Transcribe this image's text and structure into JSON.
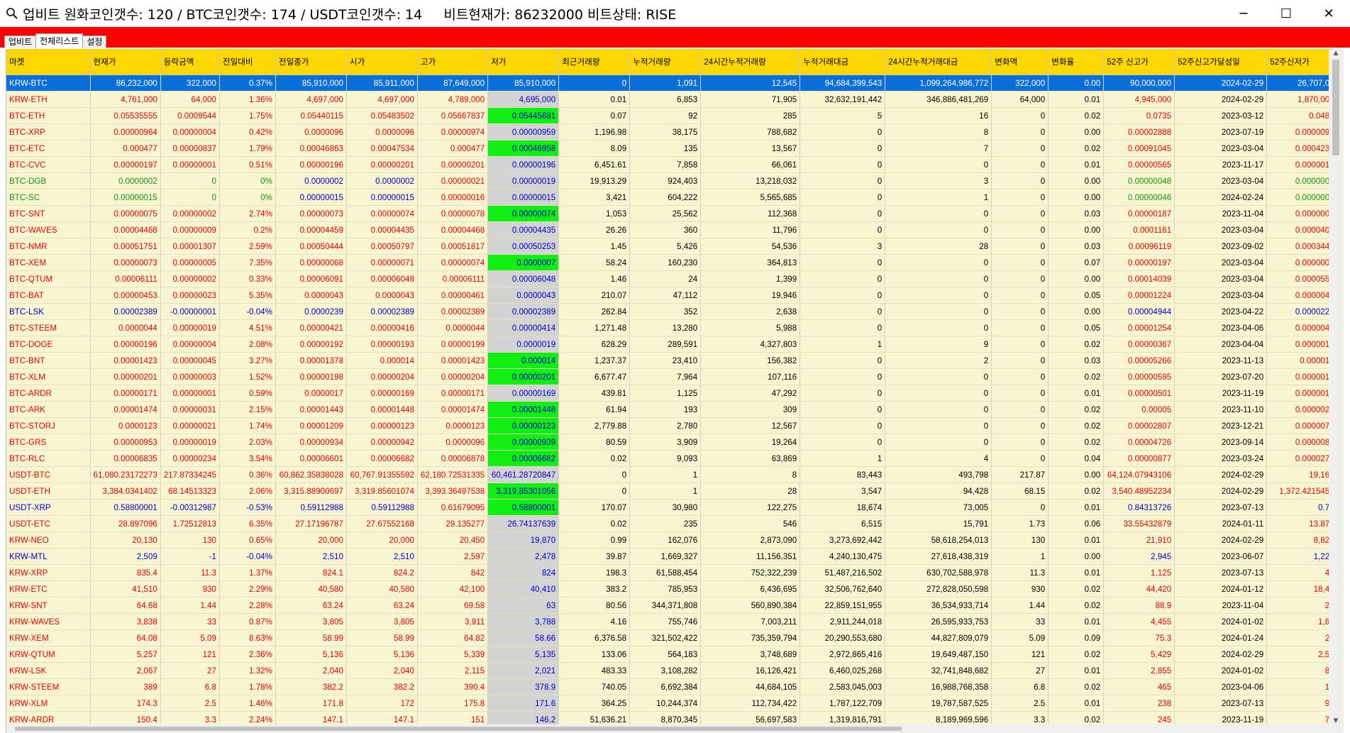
{
  "window": {
    "title": "업비트 원화코인갯수: 120 / BTC코인갯수: 174 / USDT코인갯수: 14     비트현재가: 86232000 비트상태: RISE",
    "minimize": "─",
    "maximize": "☐",
    "close": "✕"
  },
  "tabs": [
    "업비트",
    "전체리스트",
    "설정"
  ],
  "columns": [
    "마켓",
    "현재가",
    "등락금액",
    "전일대비",
    "전일종가",
    "시가",
    "고가",
    "저가",
    "최근거래량",
    "누적거래량",
    "24시간누적거래량",
    "누적거래대금",
    "24시간누적거래대금",
    "변화액",
    "변화율",
    "52주 신고가",
    "52주신고가달성일",
    "52주신저가"
  ],
  "rows": [
    {
      "c": [
        "KRW-BTC",
        "86,232,000",
        "322,000",
        "0.37%",
        "85,910,000",
        "85,911,000",
        "87,649,000",
        "85,910,000",
        "0",
        "1,091",
        "12,545",
        "94,684,399,543",
        "1,099,264,986,772",
        "322,000",
        "0.00",
        "90,000,000",
        "2024-02-29",
        "26,707,0"
      ],
      "color": "red",
      "low": "gray",
      "sel": true
    },
    {
      "c": [
        "KRW-ETH",
        "4,761,000",
        "64,000",
        "1.36%",
        "4,697,000",
        "4,697,000",
        "4,789,000",
        "4,695,000",
        "0.01",
        "6,853",
        "71,905",
        "32,632,191,442",
        "346,886,481,269",
        "64,000",
        "0.01",
        "4,945,000",
        "2024-02-29",
        "1,870,00"
      ],
      "color": "red",
      "low": "gray"
    },
    {
      "c": [
        "BTC-ETH",
        "0.05535555",
        "0.0009544",
        "1.75%",
        "0.05440115",
        "0.05483502",
        "0.05667837",
        "0.05445681",
        "0.07",
        "92",
        "285",
        "5",
        "16",
        "0",
        "0.02",
        "0.0735",
        "2023-03-12",
        "0.048"
      ],
      "color": "red",
      "low": "green"
    },
    {
      "c": [
        "BTC-XRP",
        "0.00000964",
        "0.00000004",
        "0.42%",
        "0.0000096",
        "0.0000096",
        "0.00000974",
        "0.00000959",
        "1,196.98",
        "38,175",
        "788,682",
        "0",
        "8",
        "0",
        "0.00",
        "0.00002888",
        "2023-07-19",
        "0.000009"
      ],
      "color": "red",
      "low": "gray"
    },
    {
      "c": [
        "BTC-ETC",
        "0.000477",
        "0.00000837",
        "1.79%",
        "0.00046863",
        "0.00047534",
        "0.000477",
        "0.00046958",
        "8.09",
        "135",
        "13,567",
        "0",
        "7",
        "0",
        "0.02",
        "0.00091045",
        "2023-03-04",
        "0.000423"
      ],
      "color": "red",
      "low": "green"
    },
    {
      "c": [
        "BTC-CVC",
        "0.00000197",
        "0.00000001",
        "0.51%",
        "0.00000196",
        "0.00000201",
        "0.00000201",
        "0.00000196",
        "6,451.61",
        "7,858",
        "66,061",
        "0",
        "0",
        "0",
        "0.01",
        "0.00000565",
        "2023-11-17",
        "0.000001"
      ],
      "color": "red",
      "low": "gray"
    },
    {
      "c": [
        "BTC-DGB",
        "0.0000002",
        "0",
        "0%",
        "0.0000002",
        "0.0000002",
        "0.00000021",
        "0.00000019",
        "19,913.29",
        "924,403",
        "13,218,032",
        "0",
        "3",
        "0",
        "0.00",
        "0.00000048",
        "2023-03-04",
        "0.000000"
      ],
      "color": "green",
      "low": "gray"
    },
    {
      "c": [
        "BTC-SC",
        "0.00000015",
        "0",
        "0%",
        "0.00000015",
        "0.00000015",
        "0.00000016",
        "0.00000015",
        "3,421",
        "604,222",
        "5,565,685",
        "0",
        "1",
        "0",
        "0.00",
        "0.00000046",
        "2024-02-24",
        "0.000000"
      ],
      "color": "green",
      "low": "gray"
    },
    {
      "c": [
        "BTC-SNT",
        "0.00000075",
        "0.00000002",
        "2.74%",
        "0.00000073",
        "0.00000074",
        "0.00000078",
        "0.00000074",
        "1,053",
        "25,562",
        "112,368",
        "0",
        "0",
        "0",
        "0.03",
        "0.00000187",
        "2023-11-04",
        "0.000000"
      ],
      "color": "red",
      "low": "green"
    },
    {
      "c": [
        "BTC-WAVES",
        "0.00004468",
        "0.00000009",
        "0.2%",
        "0.00004459",
        "0.00004435",
        "0.00004468",
        "0.00004435",
        "26.26",
        "360",
        "11,796",
        "0",
        "0",
        "0",
        "0.00",
        "0.0001161",
        "2023-03-04",
        "0.000040"
      ],
      "color": "red",
      "low": "gray"
    },
    {
      "c": [
        "BTC-NMR",
        "0.00051751",
        "0.00001307",
        "2.59%",
        "0.00050444",
        "0.00050797",
        "0.00051817",
        "0.00050253",
        "1.45",
        "5,426",
        "54,536",
        "3",
        "28",
        "0",
        "0.03",
        "0.00096119",
        "2023-09-02",
        "0.000344"
      ],
      "color": "red",
      "low": "gray"
    },
    {
      "c": [
        "BTC-XEM",
        "0.00000073",
        "0.00000005",
        "7.35%",
        "0.00000068",
        "0.00000071",
        "0.00000074",
        "0.0000007",
        "58.24",
        "160,230",
        "364,813",
        "0",
        "0",
        "0",
        "0.07",
        "0.00000197",
        "2023-03-04",
        "0.000000"
      ],
      "color": "red",
      "low": "green"
    },
    {
      "c": [
        "BTC-QTUM",
        "0.00006111",
        "0.00000002",
        "0.33%",
        "0.00006091",
        "0.00006048",
        "0.00006111",
        "0.00006048",
        "1.46",
        "24",
        "1,399",
        "0",
        "0",
        "0",
        "0.00",
        "0.00014039",
        "2023-03-04",
        "0.000055"
      ],
      "color": "red",
      "low": "gray"
    },
    {
      "c": [
        "BTC-BAT",
        "0.00000453",
        "0.00000023",
        "5.35%",
        "0.0000043",
        "0.0000043",
        "0.00000461",
        "0.0000043",
        "210.07",
        "47,112",
        "19,946",
        "0",
        "0",
        "0",
        "0.05",
        "0.00001224",
        "2023-03-04",
        "0.000004"
      ],
      "color": "red",
      "low": "gray"
    },
    {
      "c": [
        "BTC-LSK",
        "0.00002389",
        "-0.00000001",
        "-0.04%",
        "0.0000239",
        "0.00002389",
        "0.00002389",
        "0.00002389",
        "262.84",
        "352",
        "2,638",
        "0",
        "0",
        "0",
        "0.00",
        "0.00004944",
        "2023-04-22",
        "0.000022"
      ],
      "color": "blue",
      "low": "gray"
    },
    {
      "c": [
        "BTC-STEEM",
        "0.0000044",
        "0.00000019",
        "4.51%",
        "0.00000421",
        "0.00000416",
        "0.0000044",
        "0.00000414",
        "1,271.48",
        "13,280",
        "5,988",
        "0",
        "0",
        "0",
        "0.05",
        "0.00001254",
        "2023-04-06",
        "0.000004"
      ],
      "color": "red",
      "low": "gray"
    },
    {
      "c": [
        "BTC-DOGE",
        "0.00000196",
        "0.00000004",
        "2.08%",
        "0.00000192",
        "0.00000193",
        "0.00000199",
        "0.0000019",
        "628.29",
        "289,591",
        "4,327,803",
        "1",
        "9",
        "0",
        "0.02",
        "0.00000367",
        "2023-04-04",
        "0.000001"
      ],
      "color": "red",
      "low": "gray"
    },
    {
      "c": [
        "BTC-BNT",
        "0.00001423",
        "0.00000045",
        "3.27%",
        "0.00001378",
        "0.000014",
        "0.00001423",
        "0.000014",
        "1,237.37",
        "23,410",
        "156,382",
        "0",
        "2",
        "0",
        "0.03",
        "0.00005266",
        "2023-11-13",
        "0.00001"
      ],
      "color": "red",
      "low": "green"
    },
    {
      "c": [
        "BTC-XLM",
        "0.00000201",
        "0.00000003",
        "1.52%",
        "0.00000198",
        "0.00000204",
        "0.00000204",
        "0.00000201",
        "6,677.47",
        "7,964",
        "107,116",
        "0",
        "0",
        "0",
        "0.02",
        "0.00000595",
        "2023-07-20",
        "0.000001"
      ],
      "color": "red",
      "low": "green"
    },
    {
      "c": [
        "BTC-ARDR",
        "0.00000171",
        "0.00000001",
        "0.59%",
        "0.0000017",
        "0.00000169",
        "0.00000171",
        "0.00000169",
        "439.81",
        "1,125",
        "47,292",
        "0",
        "0",
        "0",
        "0.01",
        "0.00000501",
        "2023-11-19",
        "0.000001"
      ],
      "color": "red",
      "low": "gray"
    },
    {
      "c": [
        "BTC-ARK",
        "0.00001474",
        "0.00000031",
        "2.15%",
        "0.00001443",
        "0.00001448",
        "0.00001474",
        "0.00001448",
        "61.94",
        "193",
        "309",
        "0",
        "0",
        "0",
        "0.02",
        "0.00005",
        "2023-11-10",
        "0.000002"
      ],
      "color": "red",
      "low": "green"
    },
    {
      "c": [
        "BTC-STORJ",
        "0.0000123",
        "0.00000021",
        "1.74%",
        "0.00001209",
        "0.00000123",
        "0.0000123",
        "0.00000123",
        "2,779.88",
        "2,780",
        "12,567",
        "0",
        "0",
        "0",
        "0.02",
        "0.00002807",
        "2023-12-21",
        "0.000007"
      ],
      "color": "red",
      "low": "green"
    },
    {
      "c": [
        "BTC-GRS",
        "0.00000953",
        "0.00000019",
        "2.03%",
        "0.00000934",
        "0.00000942",
        "0.0000096",
        "0.00000939",
        "80.59",
        "3,909",
        "19,264",
        "0",
        "0",
        "0",
        "0.02",
        "0.00004726",
        "2023-09-14",
        "0.000008"
      ],
      "color": "red",
      "low": "green"
    },
    {
      "c": [
        "BTC-RLC",
        "0.00006835",
        "0.00000234",
        "3.54%",
        "0.00006601",
        "0.00006682",
        "0.00006878",
        "0.00006682",
        "0.02",
        "9,093",
        "63,869",
        "1",
        "4",
        "0",
        "0.04",
        "0.00000877",
        "2023-03-24",
        "0.000027"
      ],
      "color": "red",
      "low": "green"
    },
    {
      "c": [
        "USDT-BTC",
        "61,080.23172273",
        "217.87334245",
        "0.36%",
        "60,862.35838028",
        "60,767.91355592",
        "62,180.72531335",
        "60,461.28720847",
        "0",
        "1",
        "8",
        "83,443",
        "493,798",
        "217.87",
        "0.00",
        "64,124.07943106",
        "2024-02-29",
        "19,16"
      ],
      "color": "red",
      "low": "gray"
    },
    {
      "c": [
        "USDT-ETH",
        "3,384.0341402",
        "68.14513323",
        "2.06%",
        "3,315.88900697",
        "3,319.85601074",
        "3,393.36497538",
        "3,319.85301056",
        "0",
        "1",
        "28",
        "3,547",
        "94,428",
        "68.15",
        "0.02",
        "3,540.48952234",
        "2024-02-29",
        "1,372.421545"
      ],
      "color": "red",
      "low": "green"
    },
    {
      "c": [
        "USDT-XRP",
        "0.58800001",
        "-0.00312987",
        "-0.53%",
        "0.59112988",
        "0.59112988",
        "0.61679095",
        "0.58800001",
        "170.07",
        "30,980",
        "122,275",
        "18,674",
        "73,005",
        "0",
        "0.01",
        "0.84313726",
        "2023-07-13",
        "0.7"
      ],
      "color": "blue",
      "low": "green"
    },
    {
      "c": [
        "USDT-ETC",
        "28.897096",
        "1.72512813",
        "6.35%",
        "27.17196787",
        "27.67552168",
        "29.135277",
        "26.74137639",
        "0.02",
        "235",
        "546",
        "6,515",
        "15,791",
        "1.73",
        "0.06",
        "33.55432879",
        "2024-01-11",
        "13.87"
      ],
      "color": "red",
      "low": "gray"
    },
    {
      "c": [
        "KRW-NEO",
        "20,130",
        "130",
        "0.65%",
        "20,000",
        "20,000",
        "20,450",
        "19,870",
        "0.99",
        "162,076",
        "2,873,090",
        "3,273,692,442",
        "58,618,254,013",
        "130",
        "0.01",
        "21,910",
        "2024-02-29",
        "8,82"
      ],
      "color": "red",
      "low": "gray"
    },
    {
      "c": [
        "KRW-MTL",
        "2,509",
        "-1",
        "-0.04%",
        "2,510",
        "2,510",
        "2,597",
        "2,478",
        "39.87",
        "1,669,327",
        "11,156,351",
        "4,240,130,475",
        "27,618,438,319",
        "1",
        "0.00",
        "2,945",
        "2023-06-07",
        "1,22"
      ],
      "color": "blue",
      "low": "gray"
    },
    {
      "c": [
        "KRW-XRP",
        "835.4",
        "11.3",
        "1.37%",
        "824.1",
        "824.2",
        "842",
        "824",
        "198.3",
        "61,588,454",
        "752,322,239",
        "51,487,216,502",
        "630,702,588,978",
        "11.3",
        "0.01",
        "1,125",
        "2023-07-13",
        "4"
      ],
      "color": "red",
      "low": "gray"
    },
    {
      "c": [
        "KRW-ETC",
        "41,510",
        "930",
        "2.29%",
        "40,580",
        "40,580",
        "42,100",
        "40,410",
        "383.2",
        "785,953",
        "6,436,695",
        "32,506,762,640",
        "272,828,050,598",
        "930",
        "0.02",
        "44,420",
        "2024-01-12",
        "18,4"
      ],
      "color": "red",
      "low": "gray"
    },
    {
      "c": [
        "KRW-SNT",
        "64.68",
        "1.44",
        "2.28%",
        "63.24",
        "63.24",
        "69.58",
        "63",
        "80.56",
        "344,371,808",
        "560,890,384",
        "22,859,151,955",
        "36,534,933,714",
        "1.44",
        "0.02",
        "88.9",
        "2023-11-04",
        "2"
      ],
      "color": "red",
      "low": "gray"
    },
    {
      "c": [
        "KRW-WAVES",
        "3,838",
        "33",
        "0.87%",
        "3,805",
        "3,805",
        "3,911",
        "3,788",
        "4.16",
        "755,746",
        "7,003,211",
        "2,911,244,018",
        "26,595,933,753",
        "33",
        "0.01",
        "4,455",
        "2024-01-02",
        "1,6"
      ],
      "color": "red",
      "low": "gray"
    },
    {
      "c": [
        "KRW-XEM",
        "64.08",
        "5.09",
        "8.63%",
        "58.99",
        "58.99",
        "64.82",
        "58.66",
        "6,376.58",
        "321,502,422",
        "735,359,794",
        "20,290,553,680",
        "44,827,809,079",
        "5.09",
        "0.09",
        "75.3",
        "2024-01-24",
        "2"
      ],
      "color": "red",
      "low": "gray"
    },
    {
      "c": [
        "KRW-QTUM",
        "5,257",
        "121",
        "2.36%",
        "5,136",
        "5,136",
        "5,339",
        "5,135",
        "133.06",
        "564,183",
        "3,748,689",
        "2,972,865,416",
        "19,649,487,150",
        "121",
        "0.02",
        "5,429",
        "2024-02-29",
        "2,5"
      ],
      "color": "red",
      "low": "gray"
    },
    {
      "c": [
        "KRW-LSK",
        "2,067",
        "27",
        "1.32%",
        "2,040",
        "2,040",
        "2,115",
        "2,021",
        "483.33",
        "3,108,282",
        "16,126,421",
        "6,460,025,268",
        "32,741,848,682",
        "27",
        "0.01",
        "2,855",
        "2024-01-02",
        "8"
      ],
      "color": "red",
      "low": "gray"
    },
    {
      "c": [
        "KRW-STEEM",
        "389",
        "6.8",
        "1.78%",
        "382.2",
        "382.2",
        "390.4",
        "378.9",
        "740.05",
        "6,692,384",
        "44,684,105",
        "2,583,045,003",
        "16,988,768,358",
        "6.8",
        "0.02",
        "465",
        "2023-04-06",
        "1"
      ],
      "color": "red",
      "low": "gray"
    },
    {
      "c": [
        "KRW-XLM",
        "174.3",
        "2.5",
        "1.46%",
        "171.8",
        "172",
        "175.8",
        "171.6",
        "364.25",
        "10,244,374",
        "112,734,422",
        "1,787,122,709",
        "19,787,587,525",
        "2.5",
        "0.01",
        "238",
        "2023-07-13",
        "9"
      ],
      "color": "red",
      "low": "gray"
    },
    {
      "c": [
        "KRW-ARDR",
        "150.4",
        "3.3",
        "2.24%",
        "147.1",
        "147.1",
        "151",
        "146.2",
        "51,636.21",
        "8,870,345",
        "56,697,583",
        "1,319,816,791",
        "8,189,969,596",
        "3.3",
        "0.02",
        "245",
        "2023-11-19",
        "7"
      ],
      "color": "red",
      "low": "gray"
    }
  ],
  "colors": {
    "rise": "#ee0000",
    "fall": "#0000cc",
    "flat": "#119911",
    "header": "#ffd700",
    "selected": "#0a6fd8",
    "redbar": "#ff0000",
    "low_highlight": "#11ee11"
  }
}
